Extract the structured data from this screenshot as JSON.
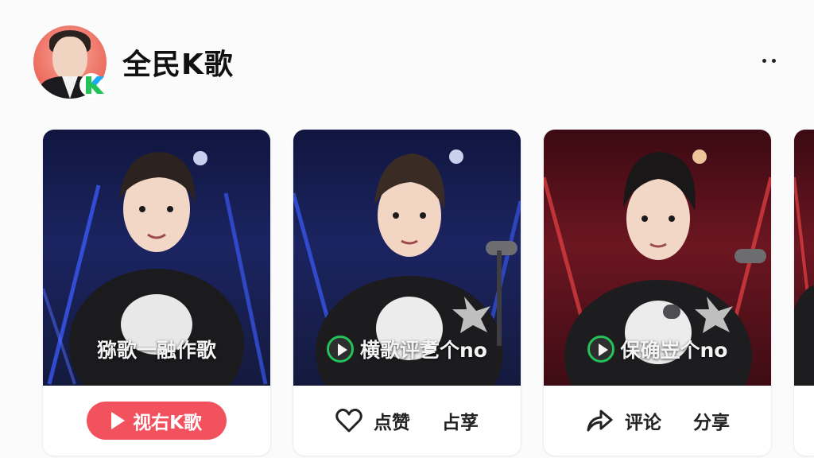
{
  "app": {
    "name": "全民K歌",
    "brand_color": "#f2525d",
    "accent_green": "#23c35a",
    "avatar_icon": "avatar-k-badge"
  },
  "cards": [
    {
      "caption": "猕歌一融作歌",
      "caption_icon": "",
      "button_label": "视右K歌",
      "theme": "blue"
    },
    {
      "caption": "横歌评乽个no",
      "caption_icon": "play-circle-icon",
      "action_left_icon": "heart-icon",
      "action_left_label": "点赞",
      "action_right_label": "占莩",
      "theme": "blue"
    },
    {
      "caption": "保确岦个no",
      "caption_icon": "play-circle-icon",
      "action_left_icon": "share-icon",
      "action_left_label": "评论",
      "action_right_label": "分享",
      "theme": "red"
    }
  ]
}
